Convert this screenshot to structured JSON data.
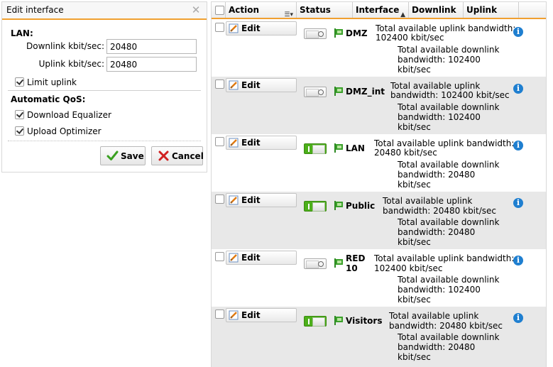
{
  "panel": {
    "title": "Edit interface",
    "lan_title": "LAN:",
    "downlink_label": "Downlink kbit/sec:",
    "downlink_value": "20480",
    "uplink_label": "Uplink kbit/sec:",
    "uplink_value": "20480",
    "limit_uplink_label": "Limit uplink",
    "qos_title": "Automatic QoS:",
    "download_equalizer_label": "Download Equalizer",
    "upload_optimizer_label": "Upload Optimizer",
    "save_label": "Save",
    "cancel_label": "Cancel"
  },
  "table": {
    "headers": {
      "action": "Action",
      "status": "Status",
      "interface": "Interface",
      "downlink": "Downlink",
      "uplink": "Uplink"
    },
    "rows": [
      {
        "edit_label": "Edit",
        "status": "off",
        "interface": "DMZ",
        "uplink_l1": "Total available uplink bandwidth:",
        "uplink_l2": "102400 kbit/sec",
        "down_l1": "Total available downlink",
        "down_l2": "bandwidth: 102400",
        "down_l3": "kbit/sec"
      },
      {
        "edit_label": "Edit",
        "status": "off",
        "interface": "DMZ_int",
        "uplink_l1": "Total available uplink",
        "uplink_l2": "bandwidth: 102400 kbit/sec",
        "down_l1": "Total available downlink",
        "down_l2": "bandwidth: 102400",
        "down_l3": "kbit/sec"
      },
      {
        "edit_label": "Edit",
        "status": "on",
        "interface": "LAN",
        "uplink_l1": "Total available uplink bandwidth:",
        "uplink_l2": "20480 kbit/sec",
        "down_l1": "Total available downlink",
        "down_l2": "bandwidth: 20480",
        "down_l3": "kbit/sec"
      },
      {
        "edit_label": "Edit",
        "status": "on",
        "interface": "Public",
        "uplink_l1": "Total available uplink",
        "uplink_l2": "bandwidth: 20480 kbit/sec",
        "down_l1": "Total available downlink",
        "down_l2": "bandwidth: 20480",
        "down_l3": "kbit/sec"
      },
      {
        "edit_label": "Edit",
        "status": "off",
        "interface_l1": "RED",
        "interface_l2": "10",
        "uplink_l1": "Total available uplink bandwidth:",
        "uplink_l2": "102400 kbit/sec",
        "down_l1": "Total available downlink",
        "down_l2": "bandwidth: 102400",
        "down_l3": "kbit/sec"
      },
      {
        "edit_label": "Edit",
        "status": "on",
        "interface": "Visitors",
        "uplink_l1": "Total available uplink",
        "uplink_l2": "bandwidth: 20480 kbit/sec",
        "down_l1": "Total available downlink",
        "down_l2": "bandwidth: 20480",
        "down_l3": "kbit/sec"
      }
    ]
  },
  "colors": {
    "accent": "#f0a030",
    "toggle_on": "#4caf1a",
    "info": "#1f7fd0",
    "save_check": "#3aa020",
    "cancel_x": "#d02020",
    "flag": "#3aa02a"
  },
  "icons": {
    "close": "close-icon",
    "check": "checkmark-icon",
    "cancel": "x-icon",
    "edit": "pencil-icon",
    "flag": "interface-flag-icon",
    "info": "info-icon",
    "columns": "column-menu-icon"
  }
}
